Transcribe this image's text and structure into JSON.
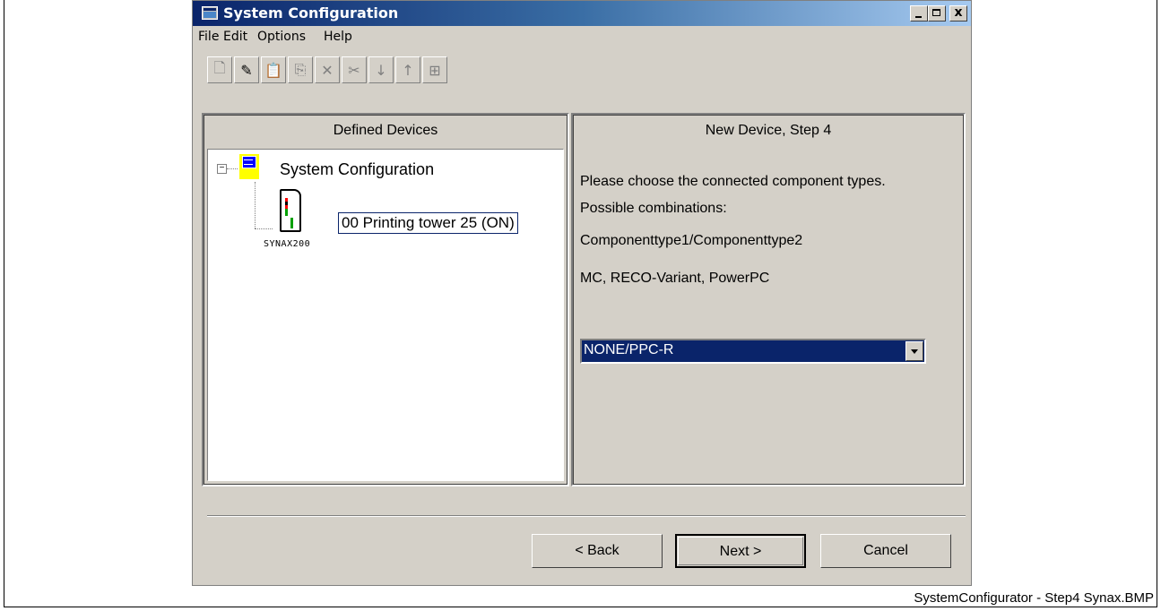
{
  "window": {
    "title": "System Configuration",
    "controls": {
      "minimize": "_",
      "maximize": "□",
      "close": "x"
    }
  },
  "menu": [
    "File",
    "Edit",
    "Options",
    "Help"
  ],
  "toolbar": {
    "buttons": [
      {
        "icon": "new-doc-icon",
        "glyph": "🗋",
        "enabled": false
      },
      {
        "icon": "edit-pen-icon",
        "glyph": "✎",
        "enabled": true
      },
      {
        "icon": "paste-icon",
        "glyph": "📋",
        "enabled": true
      },
      {
        "icon": "copy-icon",
        "glyph": "⎘",
        "enabled": false
      },
      {
        "icon": "delete-icon",
        "glyph": "✕",
        "enabled": false
      },
      {
        "icon": "cut-icon",
        "glyph": "✂",
        "enabled": false
      },
      {
        "icon": "move-down-icon",
        "glyph": "↓",
        "enabled": false
      },
      {
        "icon": "move-up-icon",
        "glyph": "↑",
        "enabled": false
      },
      {
        "icon": "tree-view-icon",
        "glyph": "⊞",
        "enabled": false
      }
    ]
  },
  "left_panel": {
    "header": "Defined Devices",
    "tree": {
      "root_label": "System Configuration",
      "expander": "−",
      "child": {
        "label": "00  Printing tower 25  (ON)",
        "caption": "SYNAX200"
      }
    }
  },
  "right_panel": {
    "header": "New Device, Step 4",
    "instructions": "Please choose the connected component types.",
    "possible_label": "Possible combinations:",
    "combination_format": "Componenttype1/Componenttype2",
    "types": "MC, RECO-Variant, PowerPC",
    "dropdown": {
      "selected": "NONE/PPC-R"
    }
  },
  "buttons": {
    "back": "< Back",
    "next": "Next >",
    "cancel": "Cancel"
  },
  "caption": "SystemConfigurator - Step4 Synax.BMP"
}
